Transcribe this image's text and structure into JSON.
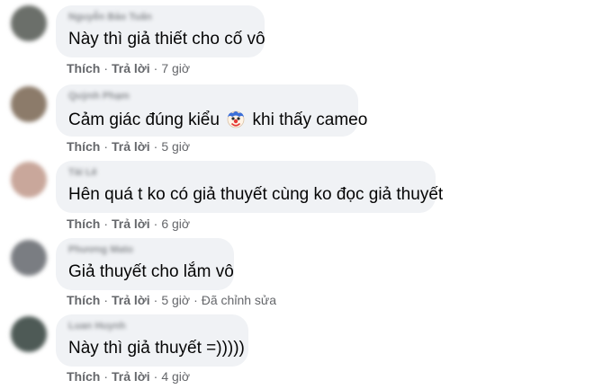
{
  "comments": [
    {
      "author": "Nguyễn Bảo Tuấn",
      "text": "Này thì giả thiết cho cố vô",
      "like": "Thích",
      "reply": "Trả lời",
      "time": "7 giờ",
      "edited": "",
      "avatar_color": "#6b6f6a"
    },
    {
      "author": "Quỳnh Phạm",
      "text_before": "Cảm giác đúng kiểu",
      "emoji": "clown-face-icon",
      "text_after": "khi thấy cameo",
      "like": "Thích",
      "reply": "Trả lời",
      "time": "5 giờ",
      "edited": "",
      "avatar_color": "#8c7b6a"
    },
    {
      "author": "Tài Lê",
      "text": "Hên quá t ko có giả thuyết cùng ko đọc giả thuyết",
      "like": "Thích",
      "reply": "Trả lời",
      "time": "6 giờ",
      "edited": "",
      "avatar_color": "#c9a79b"
    },
    {
      "author": "Phương Mato",
      "text": "Giả thuyết cho lắm vô",
      "like": "Thích",
      "reply": "Trả lời",
      "time": "5 giờ",
      "edited": "Đã chỉnh sửa",
      "avatar_color": "#7a7d82"
    },
    {
      "author": "Luan Huynh",
      "text": "Này thì giả thuyết =)))))",
      "like": "Thích",
      "reply": "Trả lời",
      "time": "4 giờ",
      "edited": "",
      "avatar_color": "#4e5a56"
    }
  ]
}
